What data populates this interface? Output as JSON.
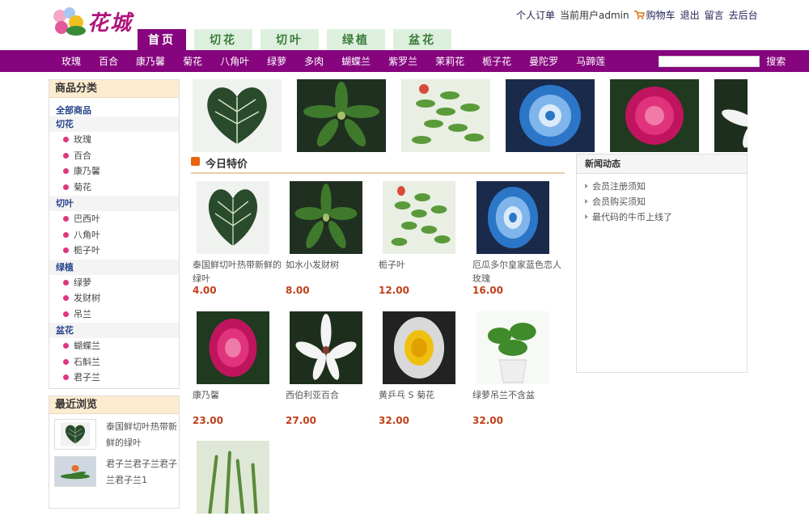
{
  "header": {
    "logo_text": "花城",
    "links": {
      "orders": "个人订单",
      "current_user": "当前用户admin",
      "cart": "购物车",
      "logout": "退出",
      "message": "留言",
      "admin": "去后台"
    }
  },
  "tabs": [
    "首页",
    "切花",
    "切叶",
    "绿植",
    "盆花"
  ],
  "nav": [
    "玫瑰",
    "百合",
    "康乃馨",
    "菊花",
    "八角叶",
    "绿萝",
    "多肉",
    "蝴蝶兰",
    "紫罗兰",
    "茉莉花",
    "栀子花",
    "曼陀罗",
    "马蹄莲"
  ],
  "search": {
    "button": "搜索",
    "value": ""
  },
  "sidebar": {
    "title": "商品分类",
    "all": "全部商品",
    "categories": [
      {
        "name": "切花",
        "items": [
          "玫瑰",
          "百合",
          "康乃馨",
          "菊花"
        ]
      },
      {
        "name": "切叶",
        "items": [
          "巴西叶",
          "八角叶",
          "栀子叶"
        ]
      },
      {
        "name": "绿植",
        "items": [
          "绿萝",
          "发财树",
          "吊兰"
        ]
      },
      {
        "name": "盆花",
        "items": [
          "蝴蝶兰",
          "石斛兰",
          "君子兰"
        ]
      }
    ]
  },
  "recent": {
    "title": "最近浏览",
    "items": [
      "泰国鲜切叶热带新鲜的绿叶",
      "君子兰君子兰君子兰君子兰1"
    ]
  },
  "today": {
    "title": "今日特价"
  },
  "news": {
    "title": "新闻动态",
    "items": [
      "会员注册须知",
      "会员购买须知",
      "最代码的牛币上线了"
    ]
  },
  "products": [
    {
      "name": "泰国鲜切叶热带新鲜的绿叶",
      "price": "4.00"
    },
    {
      "name": "如水小发财树",
      "price": "8.00"
    },
    {
      "name": "栀子叶",
      "price": "12.00"
    },
    {
      "name": "厄瓜多尔皇家蓝色恋人玫瑰",
      "price": "16.00"
    },
    {
      "name": "康乃馨",
      "price": "23.00"
    },
    {
      "name": "西伯利亚百合",
      "price": "27.00"
    },
    {
      "name": "黄乒乓 S 菊花",
      "price": "32.00"
    },
    {
      "name": "绿萝吊兰不含盆",
      "price": "32.00"
    },
    {
      "name": "",
      "price": ""
    }
  ],
  "colors": {
    "nav_bg": "#86057e",
    "tab_bg": "#ddf0dd",
    "price": "#c0401a",
    "box_title": "#feecd0"
  }
}
